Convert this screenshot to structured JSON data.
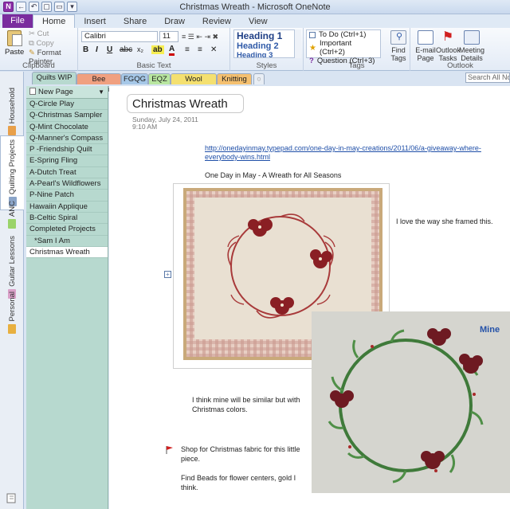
{
  "window": {
    "title": "Christmas Wreath - Microsoft OneNote",
    "qat_icons": [
      "onenote-logo-icon",
      "back-icon",
      "undo-icon",
      "dock-icon",
      "new-window-icon",
      "customize-icon"
    ]
  },
  "ribbon_tabs": [
    {
      "label": "File"
    },
    {
      "label": "Home"
    },
    {
      "label": "Insert"
    },
    {
      "label": "Share"
    },
    {
      "label": "Draw"
    },
    {
      "label": "Review"
    },
    {
      "label": "View"
    }
  ],
  "clipboard": {
    "paste": "Paste",
    "cut": "Cut",
    "copy": "Copy",
    "format_painter": "Format Painter",
    "label": "Clipboard"
  },
  "basic_text": {
    "font": "Calibri",
    "size": "11",
    "bold": "B",
    "italic": "I",
    "underline": "U",
    "label": "Basic Text"
  },
  "styles": {
    "heading1": "Heading 1",
    "heading2": "Heading 2",
    "heading3": "Heading 3",
    "label": "Styles"
  },
  "tags": {
    "items": [
      {
        "label": "To Do (Ctrl+1)",
        "icon": "checkbox-icon"
      },
      {
        "label": "Important (Ctrl+2)",
        "icon": "star-icon"
      },
      {
        "label": "Question (Ctrl+3)",
        "icon": "question-icon"
      }
    ],
    "find_tags": "Find Tags",
    "label": "Tags"
  },
  "outlook": {
    "email_page": "E-mail Page",
    "outlook_tasks": "Outlook Tasks",
    "meeting_details": "Meeting Details",
    "label": "Outlook"
  },
  "notebooks": [
    {
      "label": "Household",
      "color": "#e8a04a"
    },
    {
      "label": "Quilting Projects",
      "color": "#8aa4c8"
    },
    {
      "label": "ANC",
      "color": "#9ad36a"
    },
    {
      "label": "Guitar Lessons",
      "color": "#d9a0c8"
    },
    {
      "label": "Personal",
      "color": "#e8b040"
    }
  ],
  "sections": [
    {
      "label": "Quilts WIP",
      "color": "#b7d9cf"
    },
    {
      "label": "Bee Splendid",
      "color": "#f0a080"
    },
    {
      "label": "FGQG",
      "color": "#a6c8e8"
    },
    {
      "label": "EQZ",
      "color": "#b8e6a0"
    },
    {
      "label": "Wool Gathers",
      "color": "#f4e070"
    },
    {
      "label": "Knitting",
      "color": "#f4c070"
    }
  ],
  "search_placeholder": "Search All Notebooks",
  "page_list": {
    "new_page": "New Page",
    "pages": [
      {
        "label": "Q-Circle Play"
      },
      {
        "label": "Q-Christmas Sampler"
      },
      {
        "label": "Q-Mint Chocolate"
      },
      {
        "label": "Q-Manner's Compass"
      },
      {
        "label": "P -Friendship Quilt"
      },
      {
        "label": "E-Spring Fling"
      },
      {
        "label": "A-Dutch Treat"
      },
      {
        "label": "A-Pearl's Wildflowers"
      },
      {
        "label": "P-Nine Patch"
      },
      {
        "label": "Hawaiin Applique"
      },
      {
        "label": "B-Celtic Spiral"
      },
      {
        "label": "Completed Projects"
      },
      {
        "label": "*Sam I Am"
      },
      {
        "label": "Christmas Wreath"
      }
    ]
  },
  "page": {
    "title": "Christmas Wreath",
    "date": "Sunday, July 24, 2011",
    "time": "9:10 AM",
    "link": "http://onedayinmay.typepad.com/one-day-in-may-creations/2011/06/a-giveaway-where-everybody-wins.html",
    "subtitle": "One Day in May - A Wreath for All Seasons",
    "note_framed": "I love the way she framed this.",
    "mine_label": "Mine",
    "note_similar": "I think mine will be similar but with Christmas colors.",
    "note_shop": "Shop for Christmas fabric for this little piece.",
    "note_beads": "Find Beads for flower centers, gold I think."
  }
}
